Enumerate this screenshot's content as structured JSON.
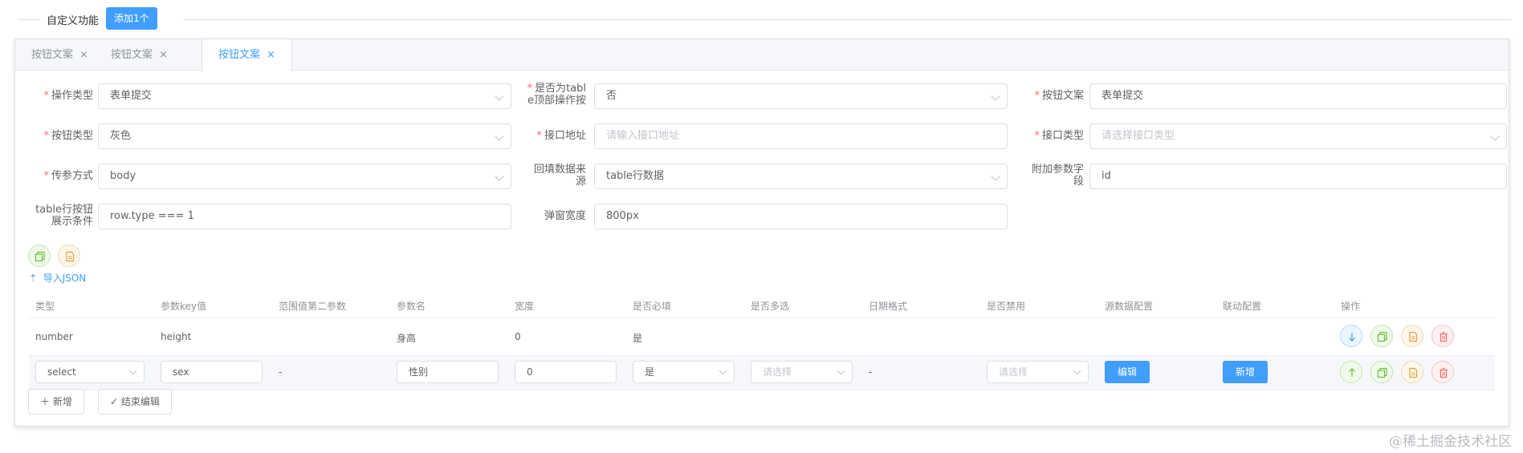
{
  "header": {
    "title": "自定义功能",
    "add_button": "添加1个"
  },
  "tabs": [
    {
      "label": "按钮文案",
      "close": "×"
    },
    {
      "label": "按钮文案",
      "close": "×"
    },
    {
      "label": "按钮文案",
      "close": "×"
    }
  ],
  "active_tab_index": 2,
  "form": {
    "operation_type": {
      "label": "操作类型",
      "value": "表单提交"
    },
    "is_table_top": {
      "label_line1": "是否为tabl",
      "label_line2": "e顶部操作按",
      "value": "否"
    },
    "button_text": {
      "label": "按钮文案",
      "value": "表单提交"
    },
    "button_type": {
      "label": "按钮类型",
      "value": "灰色"
    },
    "api_url": {
      "label": "接口地址",
      "placeholder": "请输入接口地址"
    },
    "api_type": {
      "label": "接口类型",
      "placeholder": "请选择接口类型"
    },
    "param_mode": {
      "label": "传参方式",
      "value": "body"
    },
    "backfill_source": {
      "label_line1": "回填数据来",
      "label_line2": "源",
      "value": "table行数据"
    },
    "extra_param": {
      "label_line1": "附加参数字",
      "label_line2": "段",
      "value": "id"
    },
    "row_condition": {
      "label_line1": "table行按钮",
      "label_line2": "展示条件",
      "value": "row.type === 1"
    },
    "dialog_width": {
      "label": "弹窗宽度",
      "value": "800px"
    }
  },
  "import_json": "导入JSON",
  "table": {
    "headers": [
      "类型",
      "参数key值",
      "范围值第二参数",
      "参数名",
      "宽度",
      "是否必填",
      "是否多选",
      "日期格式",
      "是否禁用",
      "源数据配置",
      "联动配置",
      "操作"
    ],
    "row1": {
      "type": "number",
      "key": "height",
      "name": "身高",
      "width": "0",
      "required": "是"
    },
    "row2": {
      "type": "select",
      "key": "sex",
      "range2": "-",
      "name": "性别",
      "width": "0",
      "required": "是",
      "multiple_placeholder": "请选择",
      "date_format": "-",
      "disabled_placeholder": "请选择",
      "source_button": "编辑",
      "link_button": "新增"
    }
  },
  "footer": {
    "add_button": "新增",
    "end_edit_button": "结束编辑"
  },
  "watermark": "@稀土掘金技术社区",
  "colors": {
    "primary": "#409eff",
    "required": "#f56c6c",
    "success": "#67c23a",
    "warning": "#e6a23c",
    "danger": "#f56c6c"
  }
}
